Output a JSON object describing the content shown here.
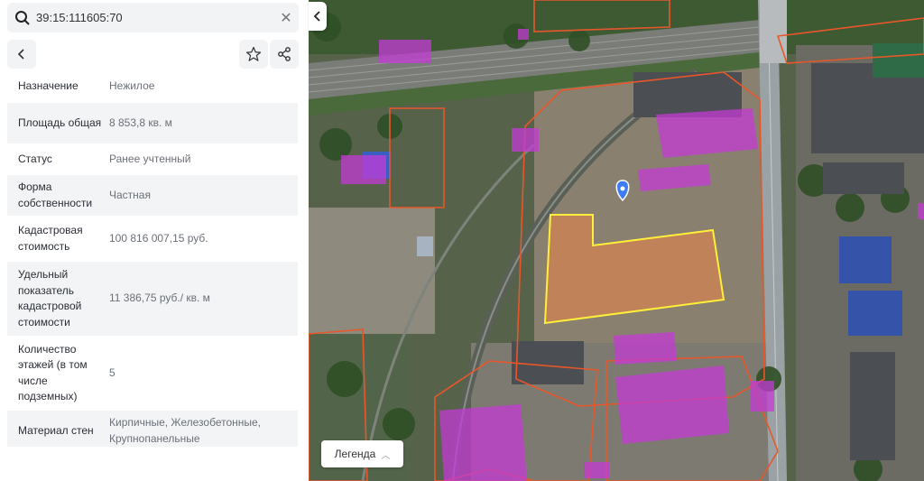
{
  "search": {
    "value": "39:15:111605:70"
  },
  "icons": {
    "search": "search-icon",
    "clear": "close-icon",
    "back": "chevron-left-icon",
    "favorite": "star-icon",
    "share": "share-icon",
    "collapse": "chevron-left-icon",
    "legend": "chevron-up-icon",
    "marker": "map-pin-icon"
  },
  "properties": [
    {
      "label": "Назначение",
      "value": "Нежилое"
    },
    {
      "label": "Площадь общая",
      "value": "8 853,8 кв. м"
    },
    {
      "label": "Статус",
      "value": "Ранее учтенный"
    },
    {
      "label": "Форма собственности",
      "value": "Частная"
    },
    {
      "label": "Кадастровая стоимость",
      "value": "100 816 007,15 руб."
    },
    {
      "label": "Удельный показатель кадастровой стоимости",
      "value": "11 386,75 руб./ кв. м"
    },
    {
      "label": "Количество этажей (в том числе подземных)",
      "value": "5"
    },
    {
      "label": "Материал стен",
      "value": "Кирпичные, Железобетонные, Крупнопанельные"
    }
  ],
  "map": {
    "legend_label": "Легенда"
  },
  "colors": {
    "parcel_border": "#e8572a",
    "building_fill": "#c43bd6",
    "selected_border": "#ffef3a",
    "selected_fill": "#c98455",
    "marker": "#3d7cf5"
  }
}
